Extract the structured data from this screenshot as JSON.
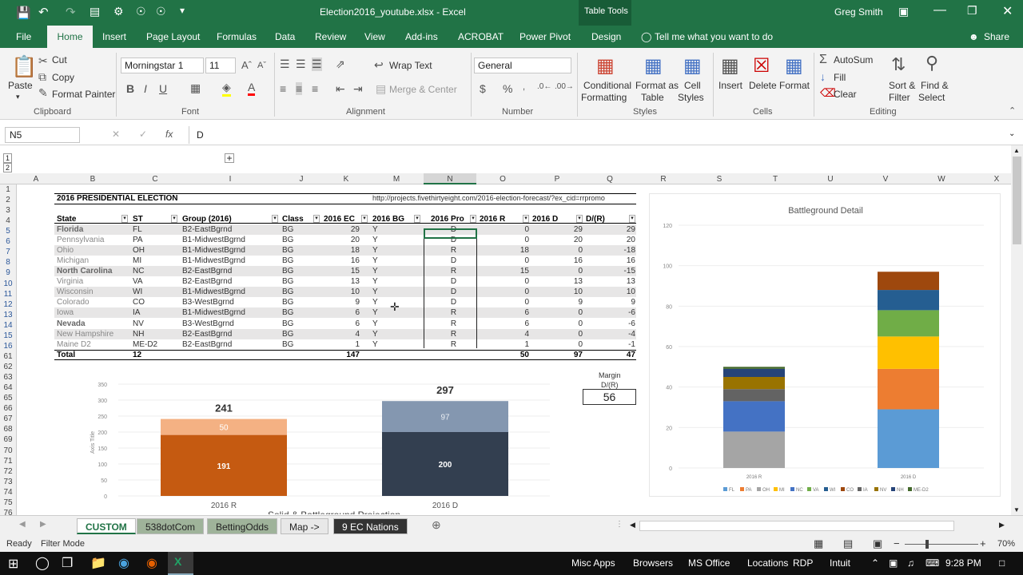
{
  "window": {
    "title": "Election2016_youtube.xlsx - Excel",
    "context_tab": "Table Tools",
    "user": "Greg Smith"
  },
  "tabs": [
    "File",
    "Home",
    "Insert",
    "Page Layout",
    "Formulas",
    "Data",
    "Review",
    "View",
    "Add-ins",
    "ACROBAT",
    "Power Pivot",
    "Design"
  ],
  "tell_me": "Tell me what you want to do",
  "share": "Share",
  "clipboard": {
    "paste": "Paste",
    "cut": "Cut",
    "copy": "Copy",
    "format_painter": "Format Painter",
    "group": "Clipboard"
  },
  "font": {
    "name": "Morningstar 1",
    "size": "11",
    "group": "Font"
  },
  "alignment": {
    "wrap": "Wrap Text",
    "merge": "Merge & Center",
    "group": "Alignment"
  },
  "number": {
    "format": "General",
    "group": "Number"
  },
  "styles": {
    "cond": "Conditional",
    "cond2": "Formatting",
    "fmt_table": "Format as",
    "fmt_table2": "Table",
    "cell_styles": "Cell",
    "cell_styles2": "Styles",
    "group": "Styles"
  },
  "cells": {
    "insert": "Insert",
    "delete": "Delete",
    "format": "Format",
    "group": "Cells"
  },
  "editing": {
    "autosum": "AutoSum",
    "fill": "Fill",
    "clear": "Clear",
    "sort": "Sort &",
    "sort2": "Filter",
    "find": "Find &",
    "find2": "Select",
    "group": "Editing"
  },
  "formula_bar": {
    "name_box": "N5",
    "fx": "fx",
    "value": "D"
  },
  "columns": [
    "A",
    "B",
    "C",
    "I",
    "J",
    "K",
    "M",
    "N",
    "O",
    "P",
    "Q",
    "R",
    "S",
    "T",
    "U",
    "V",
    "W",
    "X"
  ],
  "rows": [
    "1",
    "2",
    "3",
    "4",
    "5",
    "6",
    "7",
    "8",
    "9",
    "10",
    "11",
    "12",
    "13",
    "14",
    "15",
    "16",
    "61",
    "62",
    "63",
    "64",
    "65",
    "66",
    "67",
    "68",
    "69",
    "70",
    "71",
    "72",
    "73",
    "74",
    "75",
    "76"
  ],
  "sheet": {
    "title": "2016 PRESIDENTIAL ELECTION",
    "url": "http://projects.fivethirtyeight.com/2016-election-forecast/?ex_cid=rrpromo",
    "headers": [
      "State",
      "ST",
      "Group (2016)",
      "Class",
      "2016 EC",
      "2016 BG",
      "2016 Pro",
      "2016 R",
      "2016 D",
      "D/(R)"
    ],
    "data": [
      [
        "Florida",
        "FL",
        "B2-EastBgrnd",
        "BG",
        "29",
        "Y",
        "D",
        "0",
        "29",
        "29"
      ],
      [
        "Pennsylvania",
        "PA",
        "B1-MidwestBgrnd",
        "BG",
        "20",
        "Y",
        "D",
        "0",
        "20",
        "20"
      ],
      [
        "Ohio",
        "OH",
        "B1-MidwestBgrnd",
        "BG",
        "18",
        "Y",
        "R",
        "18",
        "0",
        "-18"
      ],
      [
        "Michigan",
        "MI",
        "B1-MidwestBgrnd",
        "BG",
        "16",
        "Y",
        "D",
        "0",
        "16",
        "16"
      ],
      [
        "North Carolina",
        "NC",
        "B2-EastBgrnd",
        "BG",
        "15",
        "Y",
        "R",
        "15",
        "0",
        "-15"
      ],
      [
        "Virginia",
        "VA",
        "B2-EastBgrnd",
        "BG",
        "13",
        "Y",
        "D",
        "0",
        "13",
        "13"
      ],
      [
        "Wisconsin",
        "WI",
        "B1-MidwestBgrnd",
        "BG",
        "10",
        "Y",
        "D",
        "0",
        "10",
        "10"
      ],
      [
        "Colorado",
        "CO",
        "B3-WestBgrnd",
        "BG",
        "9",
        "Y",
        "D",
        "0",
        "9",
        "9"
      ],
      [
        "Iowa",
        "IA",
        "B1-MidwestBgrnd",
        "BG",
        "6",
        "Y",
        "R",
        "6",
        "0",
        "-6"
      ],
      [
        "Nevada",
        "NV",
        "B3-WestBgrnd",
        "BG",
        "6",
        "Y",
        "R",
        "6",
        "0",
        "-6"
      ],
      [
        "New Hampshire",
        "NH",
        "B2-EastBgrnd",
        "BG",
        "4",
        "Y",
        "R",
        "4",
        "0",
        "-4"
      ],
      [
        "Maine D2",
        "ME-D2",
        "B2-EastBgrnd",
        "BG",
        "1",
        "Y",
        "R",
        "1",
        "0",
        "-1"
      ]
    ],
    "total": [
      "Total",
      "12",
      "147",
      "50",
      "97",
      "47"
    ],
    "margin_label": "Margin",
    "margin_sub": "D/(R)",
    "margin_value": "56"
  },
  "chart_data": [
    {
      "type": "bar",
      "categories": [
        "2016 R",
        "2016 D"
      ],
      "series": [
        {
          "values": [
            191,
            200
          ]
        },
        {
          "values": [
            50,
            97
          ]
        }
      ],
      "totals": [
        "241",
        "297"
      ],
      "ylabel": "Axis Title",
      "ylim": [
        0,
        350
      ],
      "yticks": [
        "350",
        "300",
        "250",
        "200",
        "150",
        "100",
        "50",
        "0"
      ],
      "title": "Solid & Battleground Projection",
      "colors": {
        "r_solid": "#c55a11",
        "r_bg": "#f4b183",
        "d_solid": "#333f50",
        "d_bg": "#8497b0"
      }
    },
    {
      "type": "bar",
      "title": "Battleground Detail",
      "categories": [
        "2016 R",
        "2016 D"
      ],
      "ylim": [
        0,
        120
      ],
      "yticks": [
        "120",
        "100",
        "80",
        "60",
        "40",
        "20",
        "0"
      ],
      "legend_position": "bottom",
      "series": [
        {
          "name": "FL",
          "color": "#5b9bd5",
          "values": [
            0,
            29
          ]
        },
        {
          "name": "PA",
          "color": "#ed7d31",
          "values": [
            0,
            20
          ]
        },
        {
          "name": "OH",
          "color": "#a5a5a5",
          "values": [
            18,
            0
          ]
        },
        {
          "name": "MI",
          "color": "#ffc000",
          "values": [
            0,
            16
          ]
        },
        {
          "name": "NC",
          "color": "#4472c4",
          "values": [
            15,
            0
          ]
        },
        {
          "name": "VA",
          "color": "#70ad47",
          "values": [
            0,
            13
          ]
        },
        {
          "name": "WI",
          "color": "#255e91",
          "values": [
            0,
            10
          ]
        },
        {
          "name": "CO",
          "color": "#9e480e",
          "values": [
            0,
            9
          ]
        },
        {
          "name": "IA",
          "color": "#636363",
          "values": [
            6,
            0
          ]
        },
        {
          "name": "NV",
          "color": "#997300",
          "values": [
            6,
            0
          ]
        },
        {
          "name": "NH",
          "color": "#264478",
          "values": [
            4,
            0
          ]
        },
        {
          "name": "ME-D2",
          "color": "#43682b",
          "values": [
            1,
            0
          ]
        }
      ]
    }
  ],
  "sheet_tabs": [
    "CUSTOM",
    "538dotCom",
    "BettingOdds",
    "Map ->",
    "9 EC Nations"
  ],
  "status": {
    "ready": "Ready",
    "mode": "Filter Mode",
    "zoom": "70%"
  },
  "taskbar": {
    "items": [
      "Misc Apps",
      "Browsers",
      "MS Office",
      "Locations",
      "RDP",
      "Intuit"
    ],
    "time": "9:28 PM"
  }
}
